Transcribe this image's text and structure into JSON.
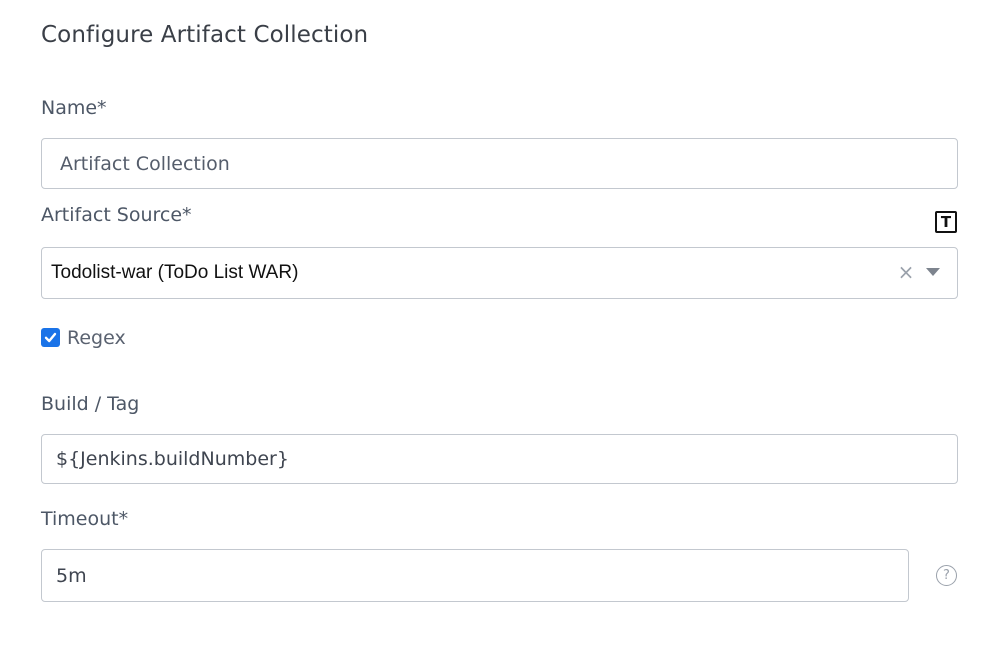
{
  "dialog": {
    "title": "Configure Artifact Collection"
  },
  "fields": {
    "name": {
      "label": "Name*",
      "value": "Artifact Collection"
    },
    "artifact_source": {
      "label": "Artifact Source*",
      "value": "Todolist-war (ToDo List WAR)",
      "template_icon": "T",
      "clear_icon": "×"
    },
    "regex": {
      "label": "Regex",
      "checked": true
    },
    "build_tag": {
      "label": "Build / Tag",
      "value": "${Jenkins.buildNumber}"
    },
    "timeout": {
      "label": "Timeout*",
      "value": "5m",
      "help_icon": "?"
    }
  },
  "icons": {
    "template": "template-t-icon",
    "clear": "clear-x-icon",
    "dropdown": "chevron-down-icon",
    "checkbox": "checkmark-icon",
    "help": "help-circle-icon"
  },
  "colors": {
    "accent": "#1a73e8",
    "border": "#c3c8cf",
    "label": "#4d5766",
    "title": "#3a3f47"
  }
}
